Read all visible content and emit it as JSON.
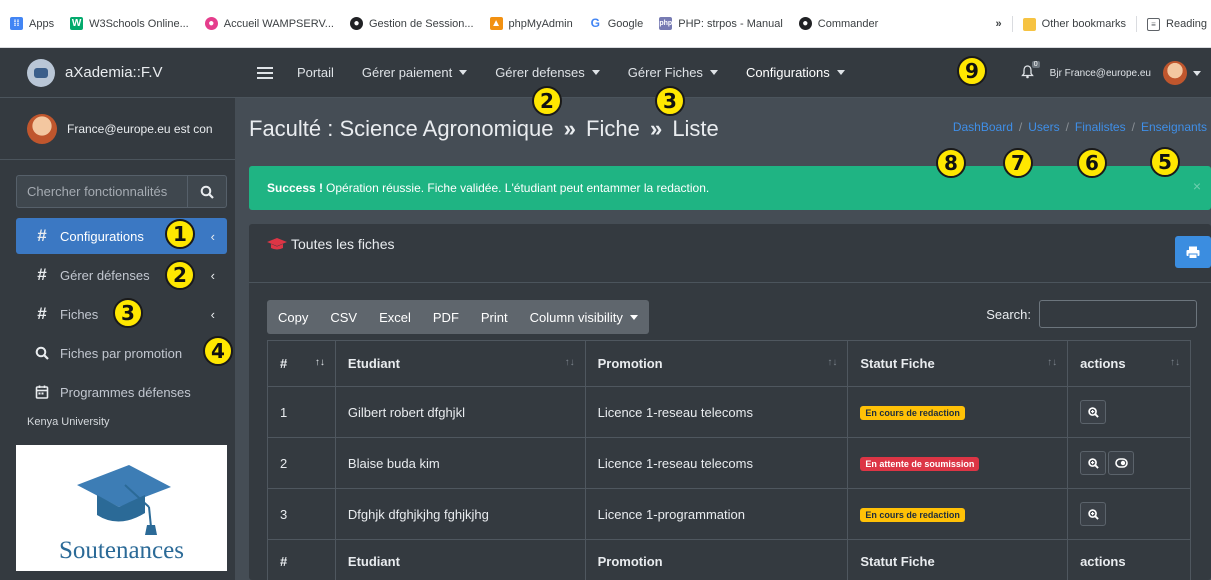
{
  "bookmarks": {
    "items": [
      {
        "label": "Apps",
        "color": "#4285f4"
      },
      {
        "label": "W3Schools Online...",
        "color": "#04aa6d"
      },
      {
        "label": "Accueil WAMPSERV...",
        "color": "#e53d8c"
      },
      {
        "label": "Gestion de Session...",
        "color": "#202124"
      },
      {
        "label": "phpMyAdmin",
        "color": "#f29111"
      },
      {
        "label": "Google",
        "color": "#4285f4"
      },
      {
        "label": "PHP: strpos - Manual",
        "color": "#777bb3"
      },
      {
        "label": "Commander",
        "color": "#202124"
      }
    ],
    "overflow": "»",
    "other": "Other bookmarks",
    "reading": "Reading"
  },
  "sidebar": {
    "brand": "aXademia::F.V",
    "user": "France@europe.eu est con",
    "search_placeholder": "Chercher fonctionnalités",
    "items": [
      {
        "label": "Configurations",
        "icon": "#",
        "active": true,
        "chevron": "‹"
      },
      {
        "label": "Gérer défenses",
        "icon": "#",
        "chevron": "‹"
      },
      {
        "label": "Fiches",
        "icon": "#",
        "chevron": "‹"
      },
      {
        "label": "Fiches par promotion",
        "icon": "search-icon"
      },
      {
        "label": "Programmes défenses",
        "icon": "calendar-icon"
      }
    ],
    "header": "Kenya University",
    "promo_text": "Soutenances"
  },
  "topnav": {
    "links": [
      {
        "label": "Portail",
        "dropdown": false
      },
      {
        "label": "Gérer paiement",
        "dropdown": true
      },
      {
        "label": "Gérer defenses",
        "dropdown": true
      },
      {
        "label": "Gérer Fiches",
        "dropdown": true
      },
      {
        "label": "Configurations",
        "dropdown": true
      }
    ],
    "notif_count": "0",
    "greeting": "Bjr France@europe.eu"
  },
  "content": {
    "title_parts": [
      "Faculté : Science Agronomique",
      "»",
      "Fiche",
      "»",
      "Liste"
    ],
    "breadcrumb": [
      "DashBoard",
      "Users",
      "Finalistes",
      "Enseignants"
    ],
    "alert": {
      "strong": "Success !",
      "text": "Opération réussie. Fiche validée. L'étudiant peut entammer la redaction.",
      "close": "×"
    },
    "card_title": "Toutes les fiches",
    "dt_buttons": [
      "Copy",
      "CSV",
      "Excel",
      "PDF",
      "Print",
      "Column visibility"
    ],
    "search_label": "Search:",
    "columns": [
      "#",
      "Etudiant",
      "Promotion",
      "Statut Fiche",
      "actions"
    ],
    "rows": [
      {
        "n": "1",
        "etudiant": "Gilbert robert dfghjkl",
        "promotion": "Licence 1-reseau telecoms",
        "statut": "En cours de redaction",
        "statut_type": "warn",
        "actions": [
          "zoom-icon"
        ]
      },
      {
        "n": "2",
        "etudiant": "Blaise buda kim",
        "promotion": "Licence 1-reseau telecoms",
        "statut": "En attente de soumission",
        "statut_type": "danger",
        "actions": [
          "zoom-icon",
          "toggle-icon"
        ]
      },
      {
        "n": "3",
        "etudiant": "Dfghjk dfghjkjhg fghjkjhg",
        "promotion": "Licence 1-programmation",
        "statut": "En cours de redaction",
        "statut_type": "warn",
        "actions": [
          "zoom-icon"
        ]
      }
    ]
  },
  "annotations": [
    "1",
    "2",
    "3",
    "4",
    "2",
    "3",
    "5",
    "6",
    "7",
    "8",
    "9"
  ]
}
